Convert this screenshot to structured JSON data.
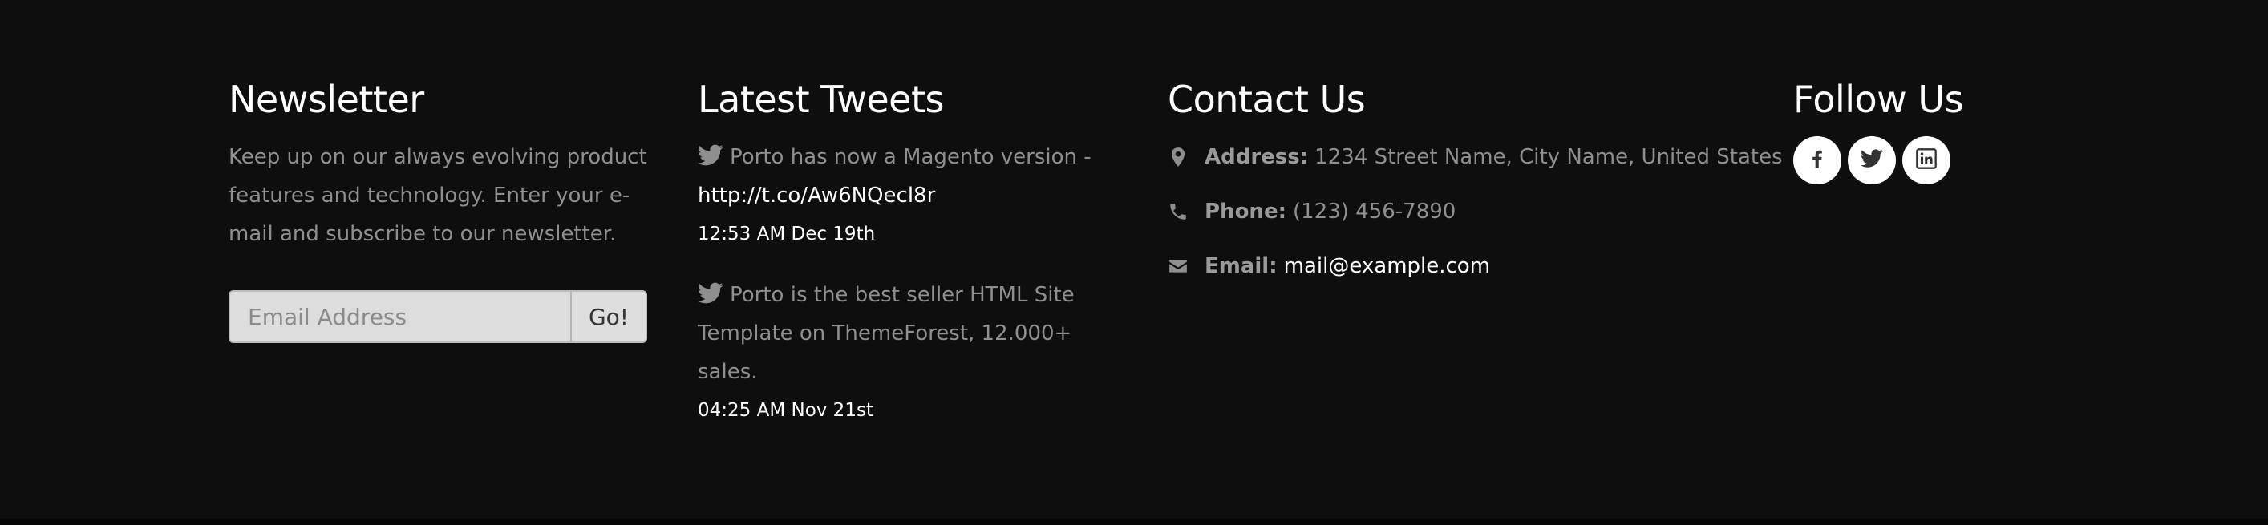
{
  "newsletter": {
    "heading": "Newsletter",
    "description": "Keep up on our always evolving product features and technology. Enter your e-mail and subscribe to our newsletter.",
    "email_placeholder": "Email Address",
    "submit_label": "Go!"
  },
  "tweets": {
    "heading": "Latest Tweets",
    "items": [
      {
        "text": "Porto has now a Magento version -",
        "link": "http://t.co/Aw6NQecl8r",
        "time": "12:53 AM Dec 19th"
      },
      {
        "text": "Porto is the best seller HTML Site Template on ThemeForest, 12.000+ sales.",
        "link": "",
        "time": "04:25 AM Nov 21st"
      }
    ],
    "icon": "twitter-bird-icon"
  },
  "contact": {
    "heading": "Contact Us",
    "address_label": "Address:",
    "address_value": "1234 Street Name, City Name, United States",
    "phone_label": "Phone:",
    "phone_value": "(123) 456-7890",
    "email_label": "Email:",
    "email_value": "mail@example.com",
    "icons": [
      "map-marker-icon",
      "phone-icon",
      "envelope-icon"
    ]
  },
  "follow": {
    "heading": "Follow Us",
    "networks": [
      "facebook-icon",
      "twitter-icon",
      "linkedin-icon"
    ]
  },
  "colors": {
    "background": "#0e0e0e",
    "heading": "#ffffff",
    "muted_text": "#8f8f8f",
    "link": "#ffffff",
    "input_bg": "#dddddd"
  }
}
